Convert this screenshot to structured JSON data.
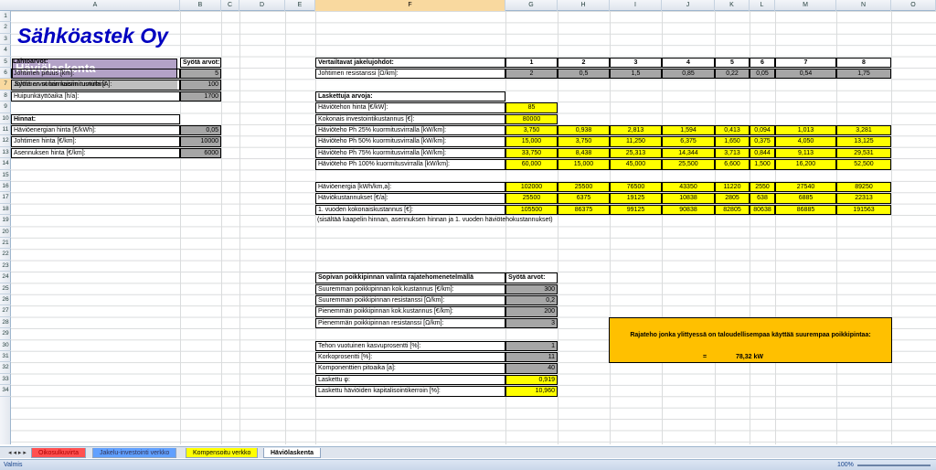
{
  "columns": [
    "A",
    "B",
    "C",
    "D",
    "E",
    "F",
    "G",
    "H",
    "I",
    "J",
    "K",
    "L",
    "M",
    "N",
    "O"
  ],
  "rows": [
    "1",
    "2",
    "3",
    "4",
    "5",
    "6",
    "7",
    "8",
    "9",
    "10",
    "11",
    "12",
    "13",
    "14",
    "15",
    "16",
    "17",
    "18",
    "19",
    "20",
    "21",
    "22",
    "23",
    "24",
    "25",
    "26",
    "27",
    "28",
    "29",
    "30",
    "31",
    "32",
    "33",
    "34"
  ],
  "company": "Sähköastek Oy",
  "sheet_title": "Häviölaskenta",
  "instruction": "Syötä arvot harmaisiin ruutuihin!",
  "inputs": {
    "header_a": "Lähtöarvot:",
    "header_b": "Syötä arvot:",
    "items": [
      {
        "label": "Johtimen pituus [km]:",
        "value": "5"
      },
      {
        "label": "Johtimen suurin kuormitusvirta [A]:",
        "value": "100"
      },
      {
        "label": "Huipunkäyttöaika [h/a]:",
        "value": "1700"
      }
    ],
    "prices_header": "Hinnat:",
    "prices": [
      {
        "label": "Häviöenergian hinta [€/kWh]:",
        "value": "0,05"
      },
      {
        "label": "Johtimen hinta [€/km]:",
        "value": "10000"
      },
      {
        "label": "Asennuksen hinta [€/km]:",
        "value": "6000"
      }
    ]
  },
  "compare": {
    "header": "Vertailtavat jakelujohdot:",
    "numbers": [
      "1",
      "2",
      "3",
      "4",
      "5",
      "6",
      "7",
      "8"
    ],
    "resist_label": "Johtimen resistanssi [Ω/km]:",
    "resist": [
      "2",
      "0,5",
      "1,5",
      "0,85",
      "0,22",
      "0,05",
      "0,54",
      "1,75"
    ]
  },
  "calc": {
    "header": "Laskettuja arvoja:",
    "loss_power_price_label": "Häviötehon hinta [€/kW]:",
    "loss_power_price": "85",
    "invest_label": "Kokonais investointikustannus [€]:",
    "invest": "80000",
    "rows": [
      {
        "label": "Häviöteho Ph 25% kuormitusvirralla [kW/km]:",
        "values": [
          "3,750",
          "0,938",
          "2,813",
          "1,594",
          "0,413",
          "0,094",
          "1,013",
          "3,281"
        ]
      },
      {
        "label": "Häviöteho Ph 50% kuormitusvirralla [kW/km]:",
        "values": [
          "15,000",
          "3,750",
          "11,250",
          "6,375",
          "1,650",
          "0,375",
          "4,050",
          "13,125"
        ]
      },
      {
        "label": "Häviöteho Ph 75% kuormitusvirralla [kW/km]:",
        "values": [
          "33,750",
          "8,438",
          "25,313",
          "14,344",
          "3,713",
          "0,844",
          "9,113",
          "29,531"
        ]
      },
      {
        "label": "Häviöteho Ph 100% kuormitusvirralla [kW/km]:",
        "values": [
          "60,000",
          "15,000",
          "45,000",
          "25,500",
          "6,600",
          "1,500",
          "16,200",
          "52,500"
        ]
      }
    ],
    "energy_rows": [
      {
        "label": "Häviöenergia [kWh/km,a]:",
        "values": [
          "102000",
          "25500",
          "76500",
          "43350",
          "11220",
          "2550",
          "27540",
          "89250"
        ]
      },
      {
        "label": "Häviökustannukset [€/a]:",
        "values": [
          "25500",
          "6375",
          "19125",
          "10838",
          "2805",
          "638",
          "6885",
          "22313"
        ]
      },
      {
        "label": "1. vuoden kokonaiskustannus  [€]:",
        "values": [
          "105500",
          "86375",
          "99125",
          "90838",
          "82805",
          "80638",
          "86885",
          "191563"
        ]
      }
    ],
    "footnote": "(sisältää kaapelin hinnan, asennuksen hinnan ja 1. vuoden häviötehokustannukset)"
  },
  "boundary": {
    "header": "Sopivan poikkipinnan valinta rajatehomenetelmällä",
    "header_b": "Syötä arvot:",
    "items": [
      {
        "label": "Suuremman poikkipinnan kok.kustannus  [€/km]:",
        "value": "300"
      },
      {
        "label": "Suuremman poikkipinnan resistanssi [Ω/km]:",
        "value": "0,2"
      },
      {
        "label": "Pienemmän poikkipinnan kok.kustannus  [€/km]:",
        "value": "200"
      },
      {
        "label": "Pienemmän poikkipinnan resistanssi [Ω/km]:",
        "value": "3"
      }
    ],
    "items2": [
      {
        "label": "Tehon vuotuinen kasvuprosentti [%]:",
        "value": "1"
      },
      {
        "label": "Korkoprosentti [%]:",
        "value": "11"
      },
      {
        "label": "Komponenttien pitoaika [a]:",
        "value": "40"
      }
    ],
    "results": [
      {
        "label": "Laskettu φ:",
        "value": "0,919"
      },
      {
        "label": "Laskettu häviöiden kapitalisointikerroin [%]:",
        "value": "10,960"
      }
    ]
  },
  "output": {
    "text": "Rajateho jonka ylittyessä on taloudellisempaa käyttää suurempaa poikkipintaa:",
    "eq": "=",
    "value": "78,32 kW"
  },
  "tabs": [
    "Oikosulkuvirta",
    "Jakelu-investointi verkko",
    "Kompensoitu verkko",
    "Häviölaskenta"
  ],
  "status": {
    "ready": "Valmis",
    "zoom": "100%"
  },
  "colors": {
    "grey": "#a6a6a6",
    "yellow": "#ffff00",
    "orange": "#ffc000",
    "title": "#0000c0",
    "header_purple": "#b3a2c7"
  }
}
